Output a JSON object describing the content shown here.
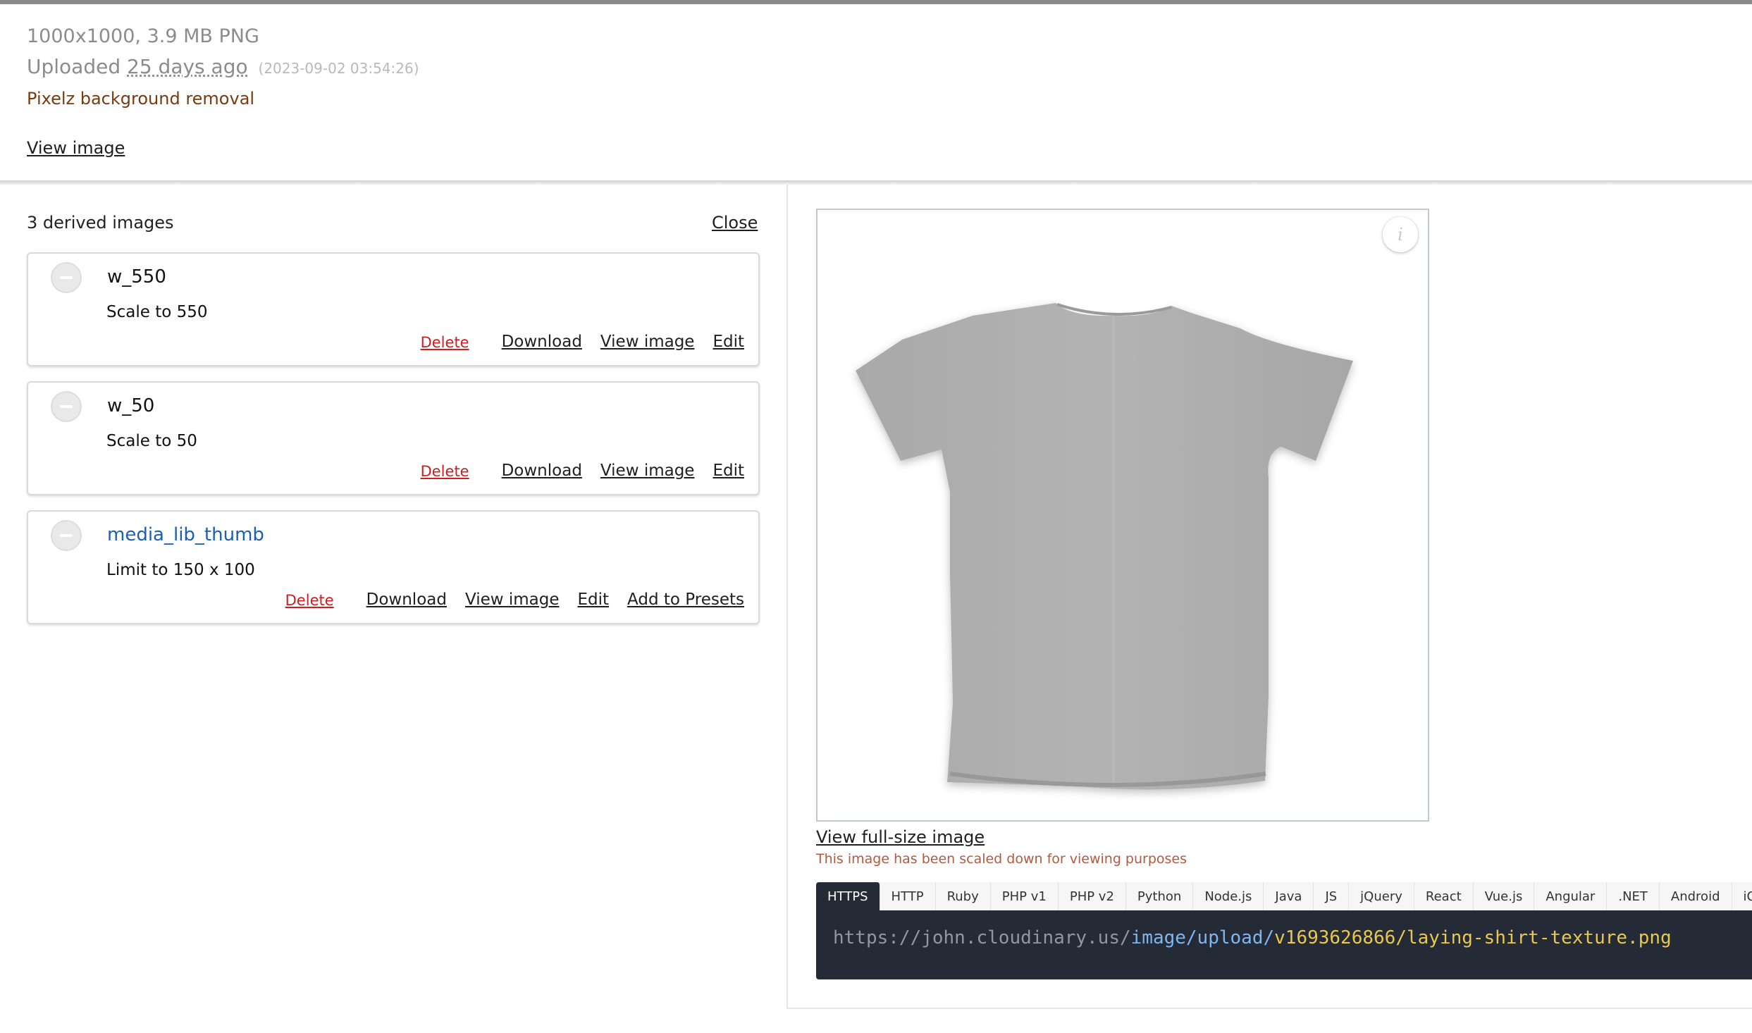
{
  "header": {
    "meta": "1000x1000, 3.9 MB PNG",
    "uploaded_label": "Uploaded",
    "uploaded_ago": "25 days ago",
    "uploaded_timestamp": "(2023-09-02 03:54:26)",
    "addon": "Pixelz background removal",
    "view_image": "View image"
  },
  "derived": {
    "count_label": "3 derived images",
    "close": "Close",
    "items": [
      {
        "name": "w_550",
        "description": "Scale to 550",
        "is_link": false,
        "actions": {
          "delete": "Delete",
          "download": "Download",
          "view": "View image",
          "edit": "Edit"
        }
      },
      {
        "name": "w_50",
        "description": "Scale to 50",
        "is_link": false,
        "actions": {
          "delete": "Delete",
          "download": "Download",
          "view": "View image",
          "edit": "Edit"
        }
      },
      {
        "name": "media_lib_thumb",
        "description": "Limit to 150 x 100",
        "is_link": true,
        "actions": {
          "delete": "Delete",
          "download": "Download",
          "view": "View image",
          "edit": "Edit",
          "add_presets": "Add to Presets"
        }
      }
    ]
  },
  "preview": {
    "info_icon": "info-icon",
    "image_subject": "grey t-shirt",
    "full_size": "View full-size image",
    "scaled_note": "This image has been scaled down for viewing purposes"
  },
  "code": {
    "tabs": [
      "HTTPS",
      "HTTP",
      "Ruby",
      "PHP v1",
      "PHP v2",
      "Python",
      "Node.js",
      "Java",
      "JS",
      "jQuery",
      "React",
      "Vue.js",
      "Angular",
      ".NET",
      "Android",
      "iOS"
    ],
    "active_tab": "HTTPS",
    "url_base": "https://john.cloudinary.us/",
    "url_path": "image/upload/",
    "url_file": "v1693626866/laying-shirt-texture.png"
  },
  "colors": {
    "delete": "#cc1f1f",
    "link_blue": "#1a5fb4",
    "code_bg": "#252b36",
    "code_base": "#8f97a3",
    "code_path": "#7fb6f0",
    "code_file": "#e9c84c",
    "addon": "#7a3a10"
  }
}
